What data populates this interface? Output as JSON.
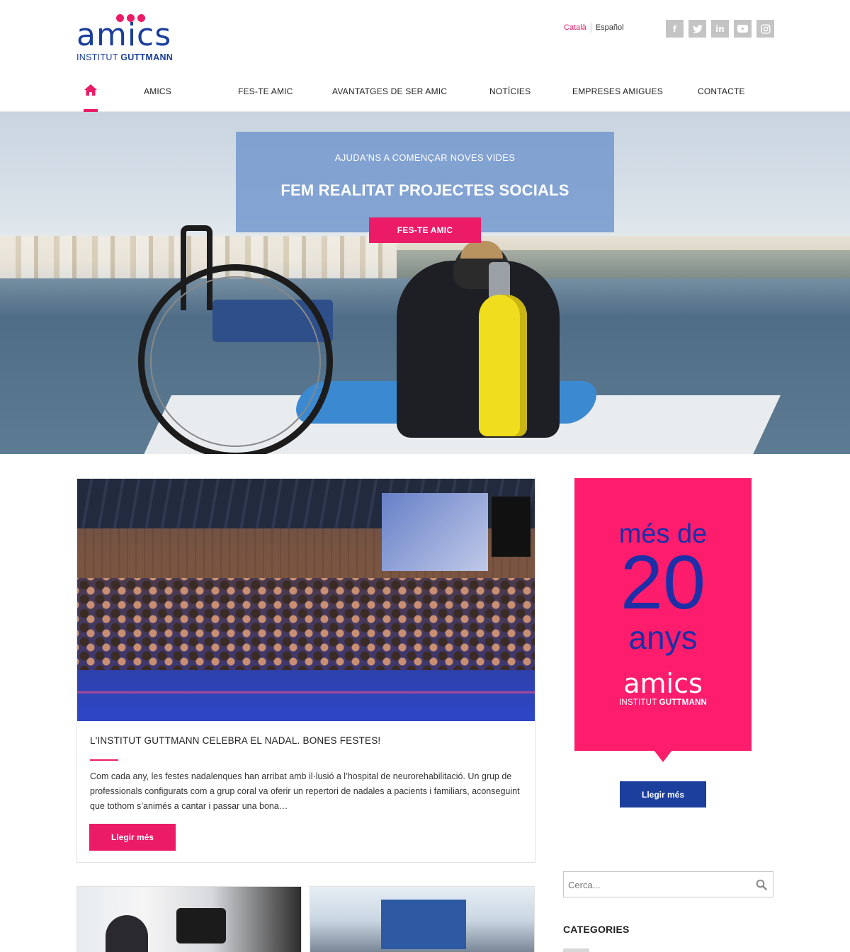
{
  "logo": {
    "word": "amics",
    "sub_prefix": "INSTITUT ",
    "sub_bold": "GUTTMANN",
    "brand_pink": "#ec1b67",
    "brand_blue": "#1a3e9c"
  },
  "languages": {
    "active": "Català",
    "other": "Español"
  },
  "social": [
    {
      "icon": "facebook-icon",
      "glyph": "f"
    },
    {
      "icon": "twitter-icon",
      "glyph": "t"
    },
    {
      "icon": "linkedin-icon",
      "glyph": "in"
    },
    {
      "icon": "youtube-icon",
      "glyph": "▶"
    },
    {
      "icon": "instagram-icon",
      "glyph": "◎"
    }
  ],
  "nav": {
    "home_icon": "home-icon",
    "items": [
      "AMICS",
      "FES-TE AMIC",
      "AVANTATGES DE SER AMIC",
      "NOTÍCIES",
      "EMPRESES AMIGUES",
      "CONTACTE"
    ]
  },
  "hero": {
    "kicker": "AJUDA'NS A COMENÇAR NOVES VIDES",
    "title": "FEM REALITAT PROJECTES SOCIALS",
    "button": "FES-TE AMIC"
  },
  "post": {
    "title": "L'INSTITUT GUTTMANN CELEBRA EL NADAL. BONES FESTES!",
    "excerpt": "Com cada any, les festes nadalenques han arribat amb il·lusió a l’hospital de neurorehabilitació. Un grup de professionals configurats com a grup coral va oferir un repertori de nadales a pacients i familiars, aconseguint que tothom s’animés a cantar i passar una bona…",
    "button": "Llegir més"
  },
  "sidebar": {
    "promo": {
      "line1": "més de",
      "number": "20",
      "line3": "anys",
      "word": "amics",
      "sub_prefix": "INSTITUT ",
      "sub_bold": "GUTTMANN",
      "background": "#fd1d6c",
      "text_color": "#1c2fa7"
    },
    "button": "Llegir més",
    "search": {
      "placeholder": "Cerca...",
      "icon": "search-icon"
    },
    "categories_title": "CATEGORIES"
  }
}
